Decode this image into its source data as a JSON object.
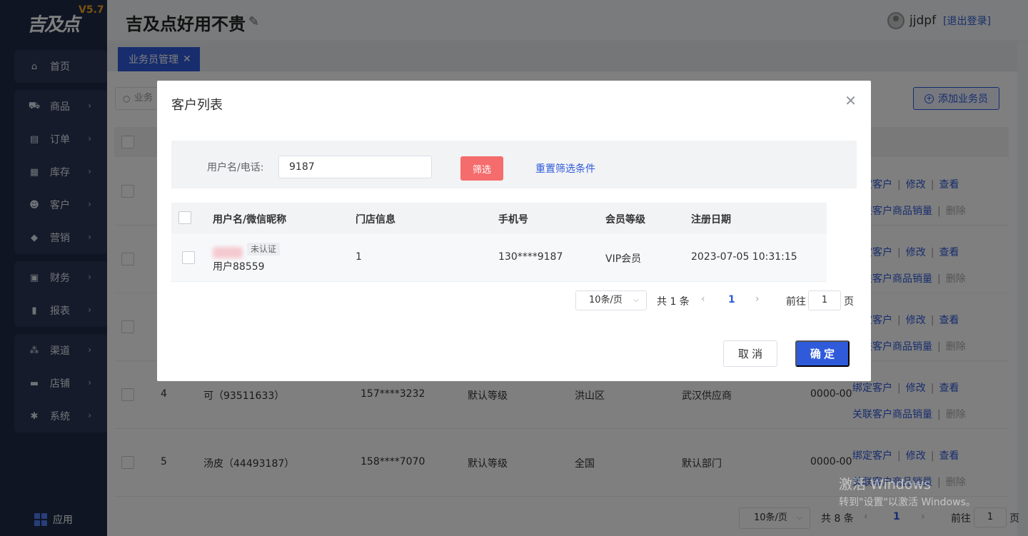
{
  "sidebar": {
    "logo_text": "吉及点",
    "version": "V5.7",
    "groups": [
      [
        {
          "label": "首页",
          "icon": "home-icon"
        }
      ],
      [
        {
          "label": "商品",
          "icon": "cart-icon"
        },
        {
          "label": "订单",
          "icon": "order-icon"
        },
        {
          "label": "库存",
          "icon": "inventory-icon"
        },
        {
          "label": "客户",
          "icon": "customer-icon"
        },
        {
          "label": "营销",
          "icon": "tag-icon"
        }
      ],
      [
        {
          "label": "财务",
          "icon": "finance-icon"
        },
        {
          "label": "报表",
          "icon": "chart-icon"
        }
      ],
      [
        {
          "label": "渠道",
          "icon": "channel-icon"
        },
        {
          "label": "店铺",
          "icon": "store-icon"
        },
        {
          "label": "系统",
          "icon": "gear-icon"
        }
      ]
    ],
    "app_label": "应用"
  },
  "header": {
    "store_name": "吉及点好用不贵",
    "username": "jjdpf",
    "logout": "[退出登录]"
  },
  "tabs": [
    {
      "label": "业务员管理"
    }
  ],
  "background": {
    "search_placeholder": "业务",
    "add_button": "添加业务员",
    "rows": [
      {
        "index": "",
        "name": "",
        "phone": "",
        "level": "",
        "area": "",
        "dept": "",
        "date": ""
      },
      {
        "index": "",
        "name": "",
        "phone": "",
        "level": "",
        "area": "",
        "dept": "",
        "date": ""
      },
      {
        "index": "",
        "name": "",
        "phone": "",
        "level": "",
        "area": "",
        "dept": "",
        "date": ""
      },
      {
        "index": "4",
        "name": "可（93511633）",
        "phone": "157****3232",
        "level": "默认等级",
        "area": "洪山区",
        "dept": "武汉供应商",
        "date": "0000-00"
      },
      {
        "index": "5",
        "name": "汤皮（44493187）",
        "phone": "158****7070",
        "level": "默认等级",
        "area": "全国",
        "dept": "默认部门",
        "date": "0000-00"
      }
    ],
    "actions": {
      "bind": "绑定客户",
      "edit": "修改",
      "view": "查看",
      "link_sales": "关联客户商品销量",
      "delete": "删除"
    },
    "pager": {
      "page_size": "10条/页",
      "total": "共 8 条",
      "current": "1",
      "goto": "前往",
      "goto_value": "1",
      "page_unit": "页"
    }
  },
  "modal": {
    "title": "客户列表",
    "filter_label": "用户名/电话:",
    "filter_value": "9187",
    "filter_button": "筛选",
    "reset_link": "重置筛选条件",
    "columns": [
      "用户名/微信昵称",
      "门店信息",
      "手机号",
      "会员等级",
      "注册日期"
    ],
    "rows": [
      {
        "tag": "未认证",
        "user": "用户88559",
        "store": "1",
        "phone": "130****9187",
        "level": "VIP会员",
        "date": "2023-07-05 10:31:15"
      }
    ],
    "pager": {
      "page_size": "10条/页",
      "total": "共 1 条",
      "current": "1",
      "goto": "前往",
      "goto_value": "1",
      "page_unit": "页"
    },
    "cancel": "取 消",
    "ok": "确 定"
  },
  "watermark": {
    "line1": "激活 Windows",
    "line2": "转到\"设置\"以激活 Windows。"
  }
}
